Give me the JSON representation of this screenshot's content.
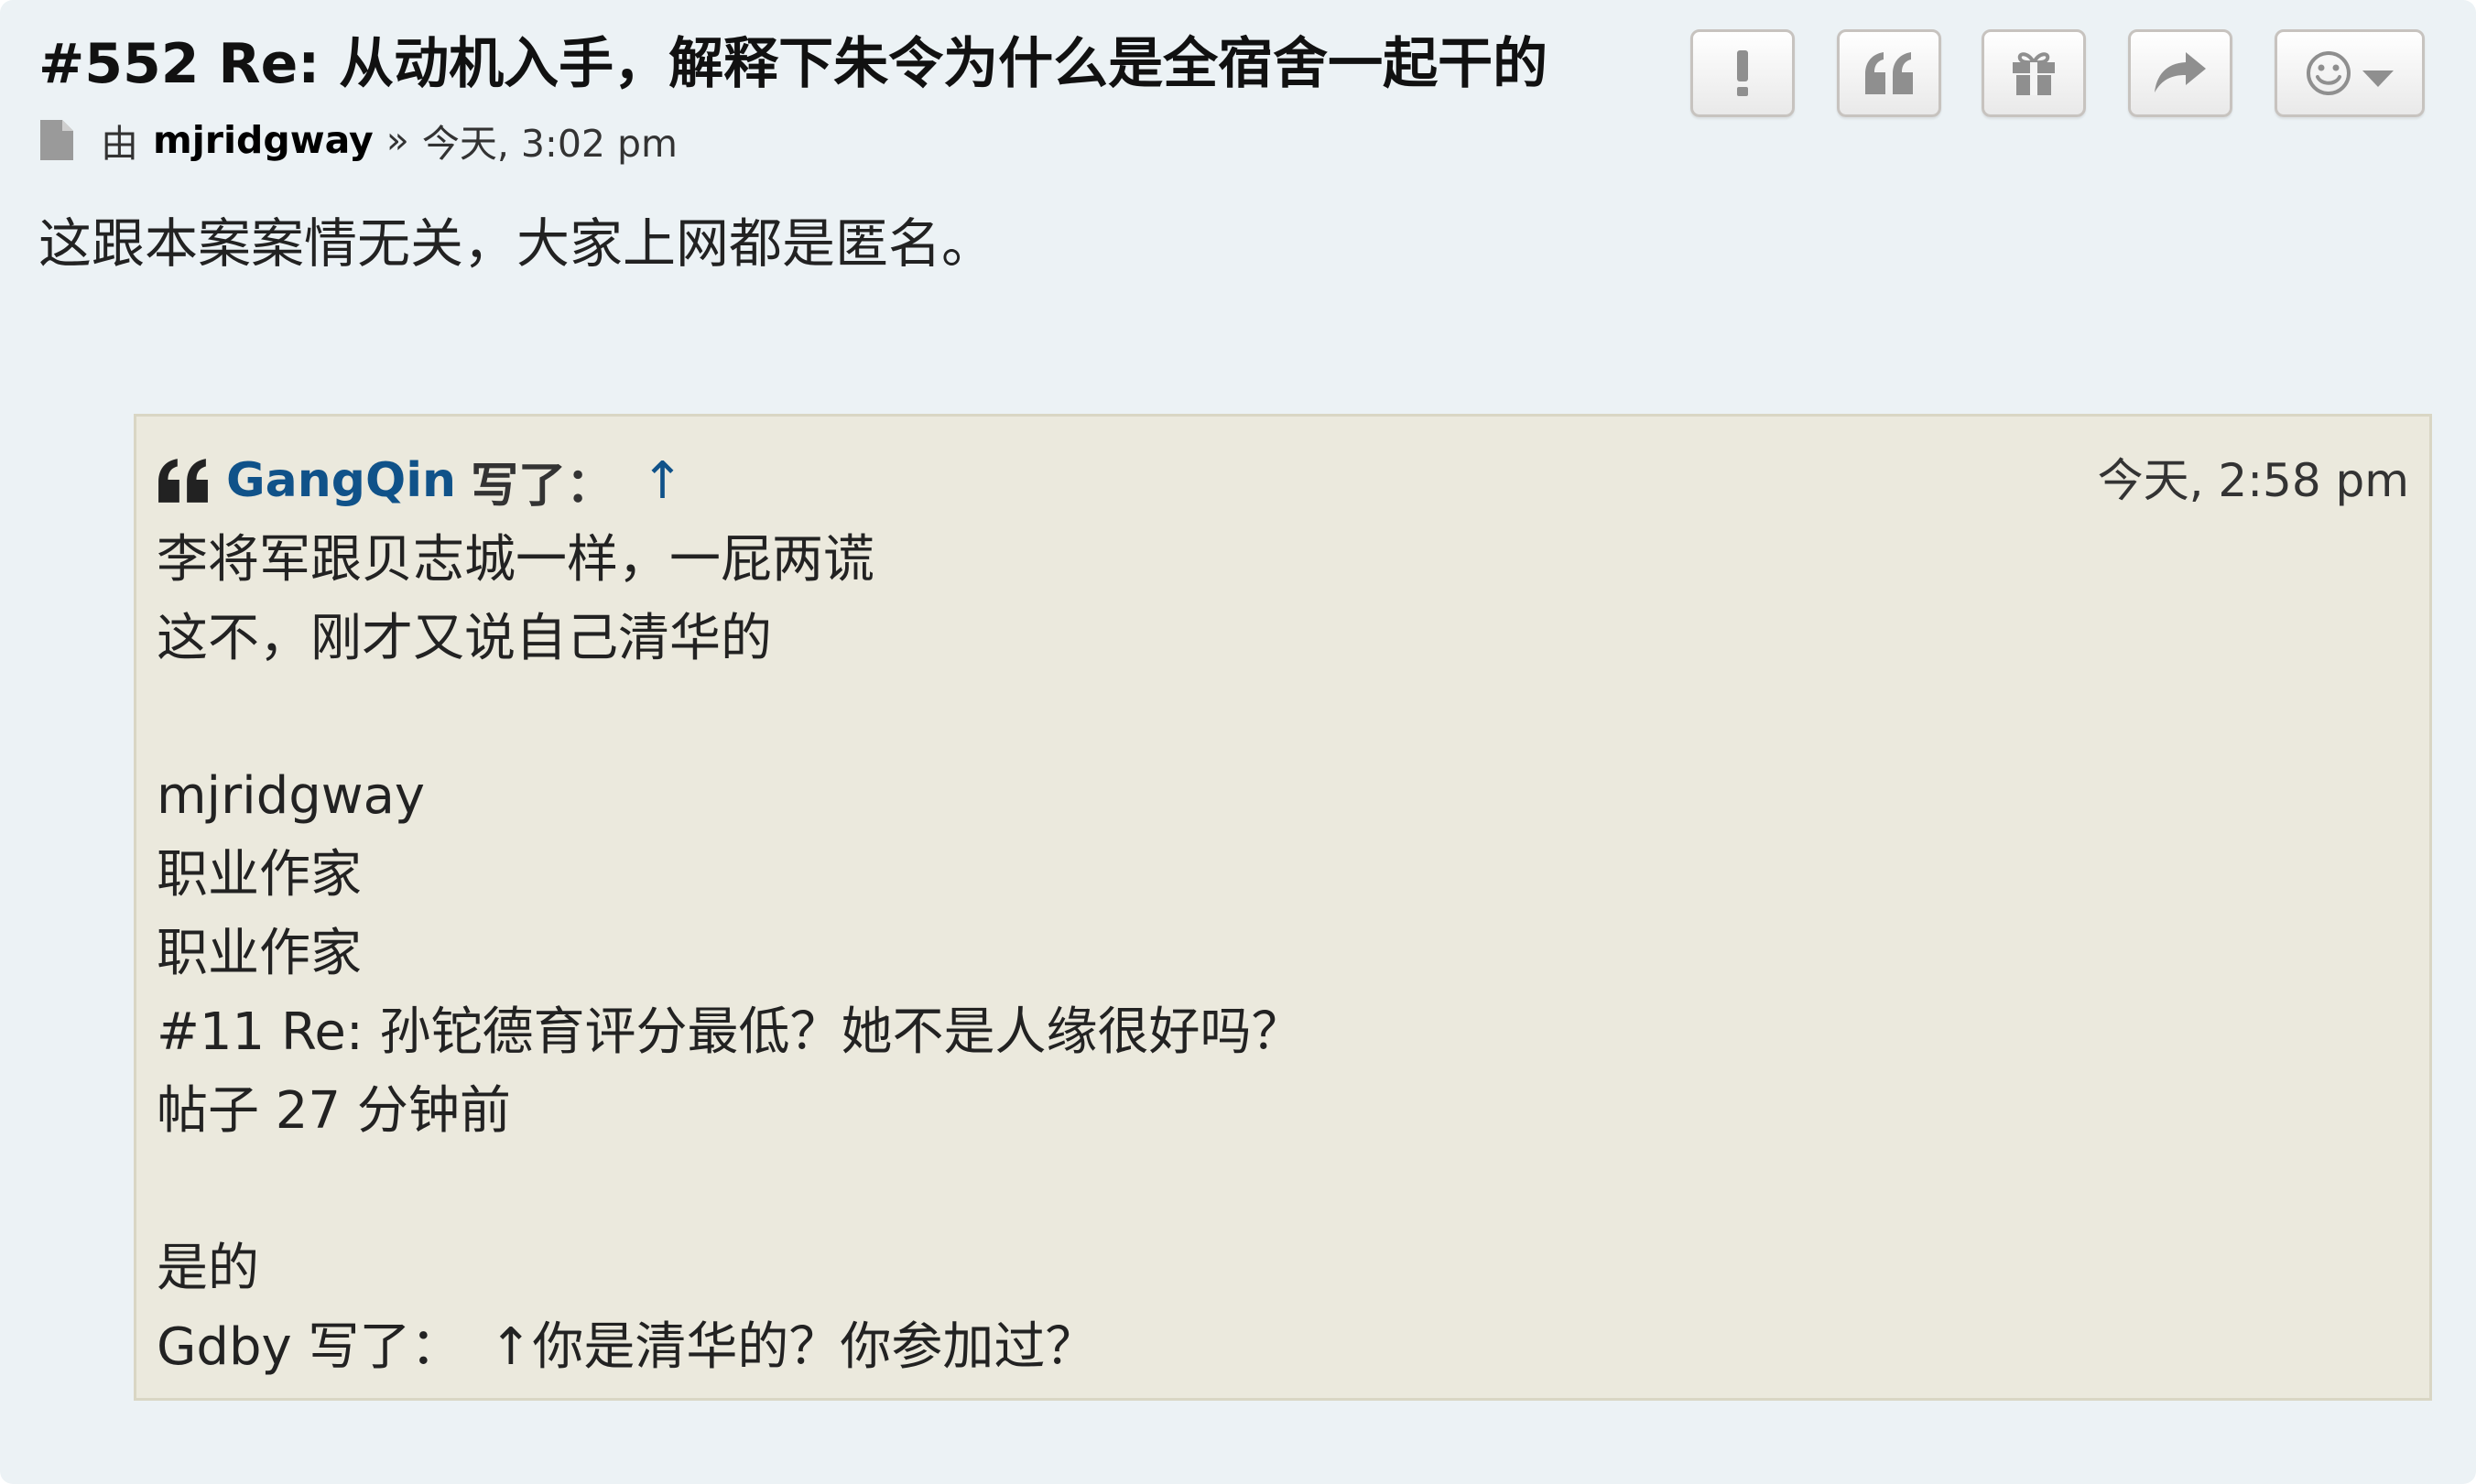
{
  "post": {
    "title": "#552 Re: 从动机入手，解释下朱令为什么是全宿舍一起干的",
    "byline": {
      "by_label": "由",
      "author": "mjridgway",
      "separator": "»",
      "time": "今天, 3:02 pm"
    },
    "text": "这跟本案案情无关，大家上网都是匿名。",
    "actions": [
      {
        "name": "report",
        "icon": "exclamation-icon"
      },
      {
        "name": "quote",
        "icon": "quote-icon"
      },
      {
        "name": "gift",
        "icon": "gift-icon"
      },
      {
        "name": "share",
        "icon": "share-arrow-icon"
      },
      {
        "name": "reactions",
        "icon": "smiley-icon"
      }
    ]
  },
  "quote": {
    "author": "GangQin",
    "wrote": "写了：",
    "arrow": "↑",
    "time": "今天, 2:58 pm",
    "lines": [
      "李将军跟贝志城一样，一屁两谎",
      "这不，刚才又说自己清华的",
      "",
      "mjridgway",
      "职业作家",
      "职业作家",
      "#11 Re: 孙铊德育评分最低？她不是人缘很好吗？",
      "帖子 27 分钟前",
      "",
      "是的"
    ],
    "last_line": {
      "prefix": "Gdby 写了：",
      "arrow": "↑",
      "rest": "你是清华的？你参加过？"
    }
  },
  "colors": {
    "post_background": "#ecf2f5",
    "quote_background": "#ebe9dd",
    "link": "#105289"
  }
}
